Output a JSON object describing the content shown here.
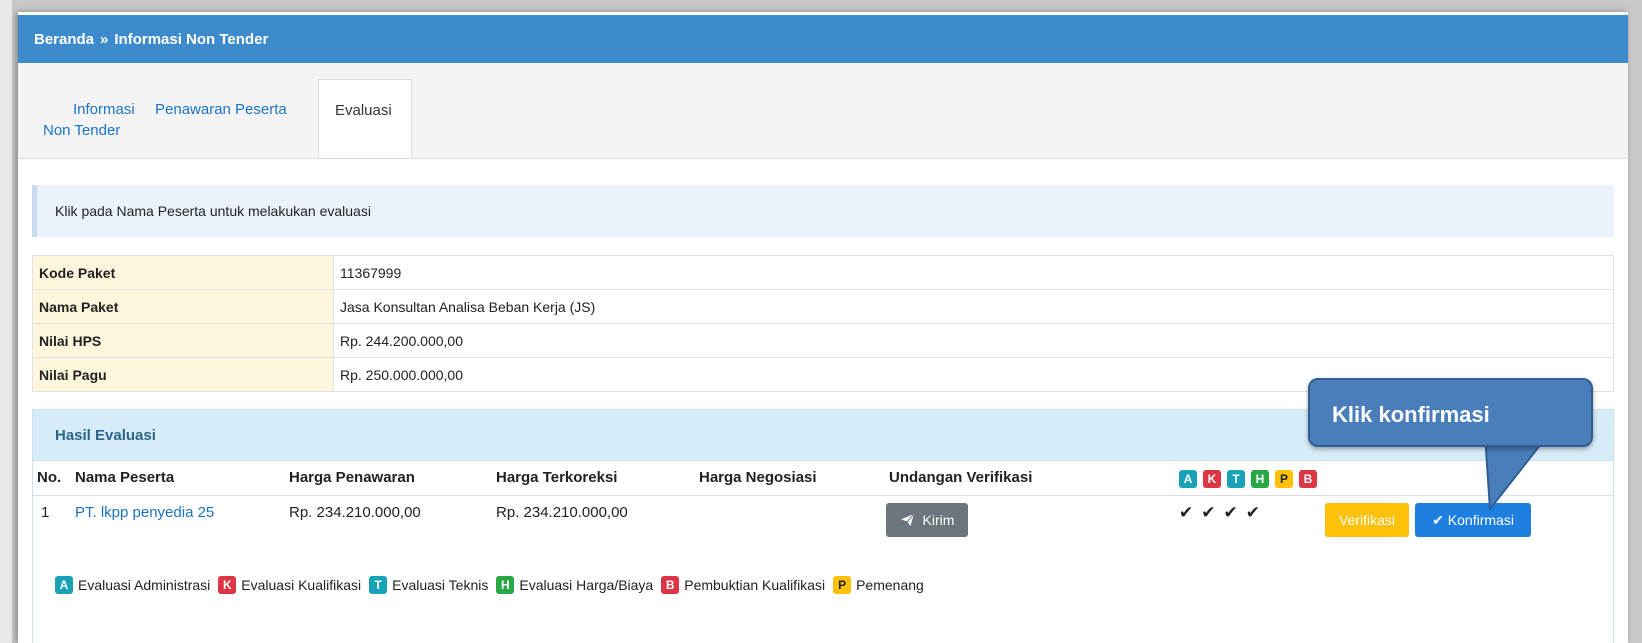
{
  "breadcrumb": {
    "home": "Beranda",
    "separator": "»",
    "current": "Informasi Non Tender"
  },
  "tabs": [
    {
      "line1": "Informasi",
      "line2": "Non Tender",
      "active": false
    },
    {
      "label": "Penawaran Peserta",
      "active": false
    },
    {
      "label": "Evaluasi",
      "active": true
    }
  ],
  "alert": "Klik pada Nama Peserta untuk melakukan evaluasi",
  "info_rows": [
    {
      "label": "Kode Paket",
      "value": "11367999"
    },
    {
      "label": "Nama Paket",
      "value": "Jasa Konsultan Analisa Beban Kerja (JS)"
    },
    {
      "label": "Nilai HPS",
      "value": "Rp. 244.200.000,00"
    },
    {
      "label": "Nilai Pagu",
      "value": "Rp. 250.000.000,00"
    }
  ],
  "evaluation": {
    "title": "Hasil Evaluasi",
    "headers": {
      "no": "No.",
      "name": "Nama Peserta",
      "offer": "Harga Penawaran",
      "corrected": "Harga Terkoreksi",
      "negotiated": "Harga Negosiasi",
      "invitation": "Undangan Verifikasi"
    },
    "badges": [
      "A",
      "K",
      "T",
      "H",
      "P",
      "B"
    ],
    "rows": [
      {
        "no": "1",
        "name": "PT. lkpp penyedia 25",
        "offer": "Rp. 234.210.000,00",
        "corrected": "Rp. 234.210.000,00",
        "negotiated": "",
        "send_label": "Kirim",
        "checks": "✔✔✔✔",
        "verify_label": "Verifikasi",
        "confirm_label": "Konfirmasi"
      }
    ],
    "legend": [
      {
        "badge": "A",
        "label": "Evaluasi Administrasi"
      },
      {
        "badge": "K",
        "label": "Evaluasi Kualifikasi"
      },
      {
        "badge": "T",
        "label": "Evaluasi Teknis"
      },
      {
        "badge": "H",
        "label": "Evaluasi Harga/Biaya"
      },
      {
        "badge": "B",
        "label": "Pembuktian Kualifikasi"
      },
      {
        "badge": "P",
        "label": "Pemenang"
      }
    ]
  },
  "callout": "Klik konfirmasi",
  "colors": {
    "topbar": "#3d8bcd",
    "link": "#1a73c9",
    "confirm": "#1e7fe0",
    "verify": "#ffc107",
    "callout": "#4a7ebb"
  }
}
